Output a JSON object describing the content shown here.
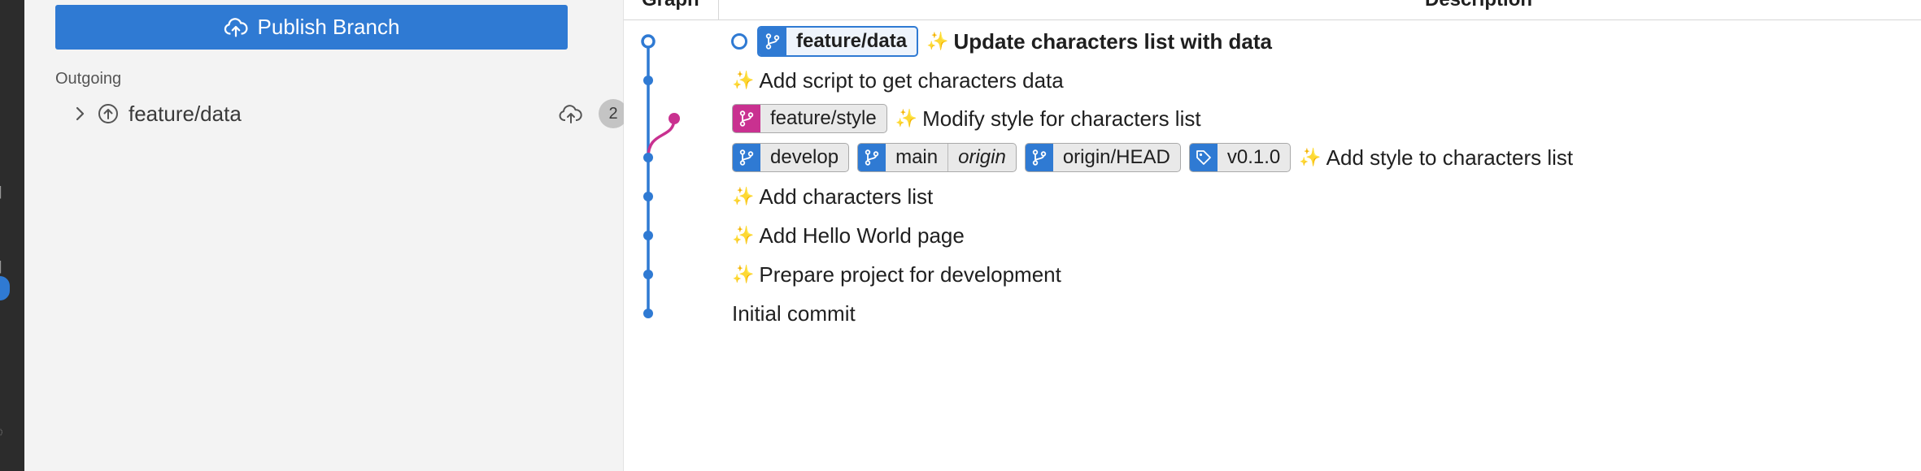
{
  "sidebar": {
    "publish_label": "Publish Branch",
    "section_label": "Outgoing",
    "branch_name": "feature/data",
    "outgoing_count": "2"
  },
  "graph": {
    "header_graph": "Graph",
    "header_description": "Description",
    "commits": [
      {
        "sparkle": "✨",
        "message": "Update characters list with data",
        "refs": [
          {
            "name": "feature/data",
            "kind": "branch",
            "current": true
          }
        ]
      },
      {
        "sparkle": "✨",
        "message": "Add script to get characters data",
        "refs": []
      },
      {
        "sparkle": "✨",
        "message": "Modify style for characters list",
        "refs": [
          {
            "name": "feature/style",
            "kind": "branch",
            "color": "#c93190"
          }
        ]
      },
      {
        "sparkle": "✨",
        "message": "Add style to characters list",
        "refs": [
          {
            "name": "develop",
            "kind": "branch"
          },
          {
            "name": "main",
            "remote": "origin",
            "kind": "branch"
          },
          {
            "name": "origin/HEAD",
            "kind": "branch"
          },
          {
            "name": "v0.1.0",
            "kind": "tag"
          }
        ]
      },
      {
        "sparkle": "✨",
        "message": "Add characters list",
        "refs": []
      },
      {
        "sparkle": "✨",
        "message": "Add Hello World page",
        "refs": []
      },
      {
        "sparkle": "✨",
        "message": "Prepare project for development",
        "refs": []
      },
      {
        "sparkle": "",
        "message": "Initial commit",
        "refs": []
      }
    ]
  },
  "colors": {
    "accent": "#2f7ad3",
    "branch_pink": "#c93190",
    "sidebar_bg": "#f3f3f3"
  },
  "icons": [
    "cloud-upload-icon",
    "chevron-right-icon",
    "arrow-up-circle-icon",
    "branch-icon",
    "tag-icon"
  ]
}
